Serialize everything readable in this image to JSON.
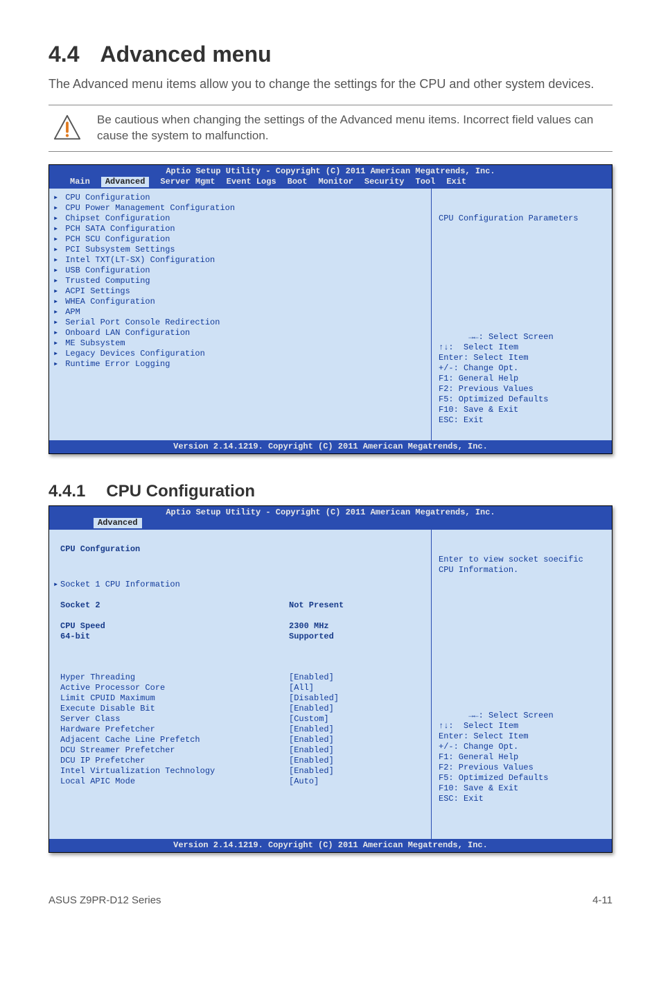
{
  "section": {
    "number": "4.4",
    "title": "Advanced menu"
  },
  "intro": "The Advanced menu items allow you to change the settings for the CPU and other system devices.",
  "note": "Be cautious when changing the settings of the Advanced menu items. Incorrect field values can cause the system to malfunction.",
  "bios1": {
    "header": "Aptio Setup Utility - Copyright (C) 2011 American Megatrends, Inc.",
    "tabs": [
      "Main",
      "Advanced",
      "Server Mgmt",
      "Event Logs",
      "Boot",
      "Monitor",
      "Security",
      "Tool",
      "Exit"
    ],
    "items": [
      "CPU Configuration",
      "CPU Power Management Configuration",
      "Chipset Configuration",
      "PCH SATA Configuration",
      "PCH SCU Configuration",
      "PCI Subsystem Settings",
      "Intel TXT(LT-SX) Configuration",
      "USB Configuration",
      "Trusted Computing",
      "ACPI Settings",
      "WHEA Configuration",
      "APM",
      "Serial Port Console Redirection",
      "Onboard LAN Configuration",
      "ME Subsystem",
      "Legacy Devices Configuration",
      "Runtime Error Logging"
    ],
    "help_top": "CPU Configuration Parameters",
    "help_nav": "→←: Select Screen\n↑↓:  Select Item\nEnter: Select Item\n+/-: Change Opt.\nF1: General Help\nF2: Previous Values\nF5: Optimized Defaults\nF10: Save & Exit\nESC: Exit",
    "footer": "Version 2.14.1219. Copyright (C) 2011 American Megatrends, Inc."
  },
  "subsection": {
    "number": "4.4.1",
    "title": "CPU Configuration"
  },
  "bios2": {
    "header": "Aptio Setup Utility - Copyright (C) 2011 American Megatrends, Inc.",
    "active_tab": "Advanced",
    "title_row": "CPU Confguration",
    "socket1": "Socket 1 CPU Information",
    "rows_top": [
      {
        "k": "Socket 2",
        "v": "Not Present"
      },
      {
        "k": "",
        "v": ""
      },
      {
        "k": "CPU Speed",
        "v": "2300 MHz"
      },
      {
        "k": "64-bit",
        "v": "Supported"
      }
    ],
    "rows_bottom": [
      {
        "k": "Hyper Threading",
        "v": "[Enabled]"
      },
      {
        "k": "Active Processor Core",
        "v": "[All]"
      },
      {
        "k": "Limit CPUID Maximum",
        "v": "[Disabled]"
      },
      {
        "k": "Execute Disable Bit",
        "v": "[Enabled]"
      },
      {
        "k": "Server Class",
        "v": "[Custom]"
      },
      {
        "k": "Hardware Prefetcher",
        "v": "[Enabled]"
      },
      {
        "k": "Adjacent Cache Line Prefetch",
        "v": "[Enabled]"
      },
      {
        "k": "DCU Streamer Prefetcher",
        "v": "[Enabled]"
      },
      {
        "k": "DCU IP Prefetcher",
        "v": "[Enabled]"
      },
      {
        "k": "Intel Virtualization Technology",
        "v": "[Enabled]"
      },
      {
        "k": "Local APIC Mode",
        "v": "[Auto]"
      }
    ],
    "help_top": "Enter to view socket soecific\nCPU Information.",
    "help_nav": "→←: Select Screen\n↑↓:  Select Item\nEnter: Select Item\n+/-: Change Opt.\nF1: General Help\nF2: Previous Values\nF5: Optimized Defaults\nF10: Save & Exit\nESC: Exit",
    "footer": "Version 2.14.1219. Copyright (C) 2011 American Megatrends, Inc."
  },
  "footer": {
    "left": "ASUS Z9PR-D12 Series",
    "right": "4-11"
  }
}
